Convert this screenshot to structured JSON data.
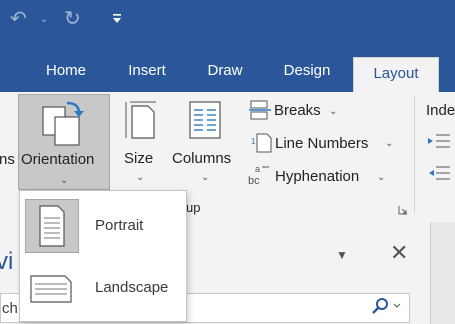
{
  "quick_access": {
    "undo_icon": "undo-icon",
    "redo_icon": "redo-icon",
    "customize_icon": "customize-quick-access-icon"
  },
  "tabs": [
    {
      "label": "Home",
      "active": false
    },
    {
      "label": "Insert",
      "active": false
    },
    {
      "label": "Draw",
      "active": false
    },
    {
      "label": "Design",
      "active": false
    },
    {
      "label": "Layout",
      "active": true
    }
  ],
  "ribbon": {
    "margins_partial": "ns",
    "orientation_label": "Orientation",
    "size_label": "Size",
    "columns_label": "Columns",
    "breaks_label": "Breaks",
    "line_numbers_label": "Line Numbers",
    "hyphenation_label": "Hyphenation",
    "group_label_partial": "up",
    "indent_partial": "Inde"
  },
  "orientation_menu": {
    "items": [
      {
        "label": "Portrait",
        "selected": true
      },
      {
        "label": "Landscape",
        "selected": false
      }
    ]
  },
  "nav_pane": {
    "title_partial": "vi",
    "search_partial": "ch"
  },
  "colors": {
    "brand": "#2b579a",
    "ribbon_bg": "#f3f3f3",
    "selected_bg": "#c8c8c8"
  }
}
